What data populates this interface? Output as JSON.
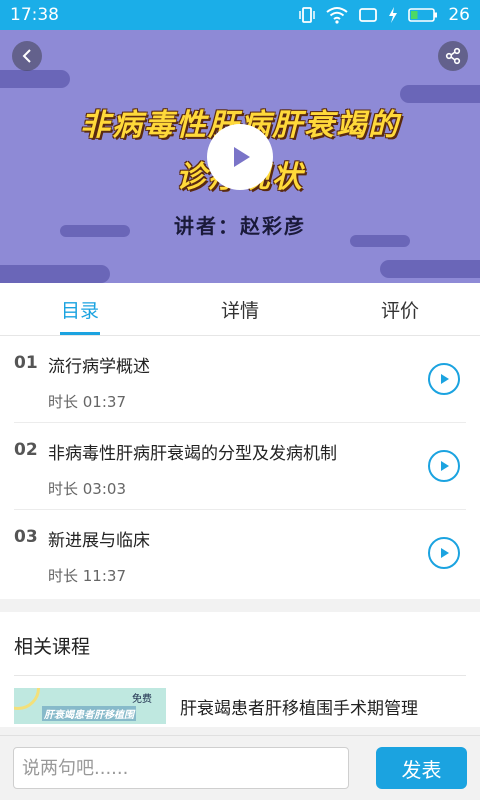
{
  "status_bar": {
    "time": "17:38",
    "battery": "26"
  },
  "hero": {
    "title_line1": "非病毒性肝病肝衰竭的",
    "title_line2": "诊疗现状",
    "speaker": "讲者：赵彩彦"
  },
  "tabs": [
    {
      "label": "目录",
      "active": true
    },
    {
      "label": "详情",
      "active": false
    },
    {
      "label": "评价",
      "active": false
    }
  ],
  "lessons": [
    {
      "num": "01",
      "title": "流行病学概述",
      "duration": "时长  01:37"
    },
    {
      "num": "02",
      "title": "非病毒性肝病肝衰竭的分型及发病机制",
      "duration": "时长  03:03"
    },
    {
      "num": "03",
      "title": "新进展与临床",
      "duration": "时长  11:37"
    }
  ],
  "related": {
    "heading": "相关课程",
    "courses": [
      {
        "thumb_tag": "免费",
        "thumb_title": "肝衰竭患者肝移植围",
        "title": "肝衰竭患者肝移植围手术期管理"
      }
    ]
  },
  "comment": {
    "placeholder": "说两句吧......",
    "submit_label": "发表"
  },
  "colors": {
    "accent": "#1ba3e0",
    "hero_bg": "#8e8ad6",
    "title_yellow": "#ffd93a"
  }
}
